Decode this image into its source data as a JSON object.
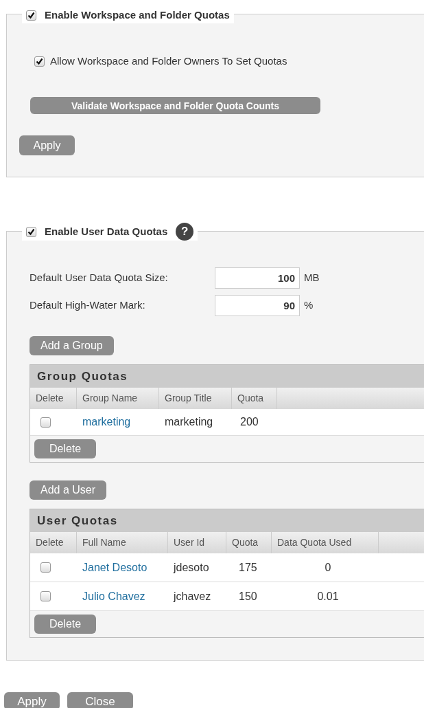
{
  "workspace_quotas": {
    "legend": "Enable Workspace and Folder Quotas",
    "enabled": true,
    "allow_owners": {
      "label": "Allow Workspace and Folder Owners To Set Quotas",
      "checked": true
    },
    "validate_button": "Validate Workspace and Folder Quota Counts",
    "apply_button": "Apply"
  },
  "user_data_quotas": {
    "legend": "Enable User Data Quotas",
    "enabled": true,
    "help_icon": "?",
    "fields": [
      {
        "label": "Default User Data Quota Size:",
        "value": "100",
        "unit": "MB"
      },
      {
        "label": "Default High-Water Mark:",
        "value": "90",
        "unit": "%"
      }
    ],
    "tables": [
      {
        "add_button": "Add a Group",
        "title": "Group Quotas",
        "columns": [
          "Delete",
          "Group Name",
          "Group Title",
          "Quota"
        ],
        "rows": [
          {
            "checked": false,
            "cells": [
              "",
              "marketing",
              "marketing",
              "200"
            ]
          }
        ],
        "delete_button": "Delete"
      },
      {
        "add_button": "Add a User",
        "title": "User Quotas",
        "columns": [
          "Delete",
          "Full Name",
          "User Id",
          "Quota",
          "Data Quota Used"
        ],
        "rows": [
          {
            "checked": false,
            "cells": [
              "",
              "Janet Desoto",
              "jdesoto",
              "175",
              "0"
            ]
          },
          {
            "checked": false,
            "cells": [
              "",
              "Julio Chavez",
              "jchavez",
              "150",
              "0.01"
            ]
          }
        ],
        "delete_button": "Delete"
      }
    ]
  },
  "footer_buttons": [
    "Apply",
    "Close"
  ]
}
